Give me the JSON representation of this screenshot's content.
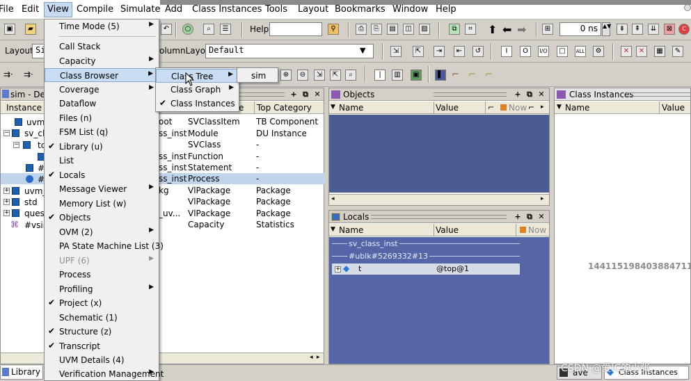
{
  "menubar": {
    "items": [
      "File",
      "Edit",
      "View",
      "Compile",
      "Simulate",
      "Add",
      "Class Instances",
      "Tools",
      "Layout",
      "Bookmarks",
      "Window",
      "Help"
    ]
  },
  "toolbar": {
    "help_label": "Help",
    "time_value": "0 ns",
    "layout_label": "Layout",
    "layout_value": "Si",
    "column_layout_label": "olumnLayout",
    "column_layout_value": "Default"
  },
  "sim_panel": {
    "title": "sim - Defa",
    "col_instance": "Instance",
    "col_design_unit_fragment": "e",
    "col_top_category": "Top Category",
    "tree_items": [
      "uvm_",
      "sv_cl",
      "tc",
      "#",
      "#",
      "uvm_",
      "std",
      "quest",
      "#vsim"
    ],
    "rows": [
      {
        "a": "oot",
        "b": "SVClassItem",
        "c": "TB Component"
      },
      {
        "a": "ss_inst",
        "b": "Module",
        "c": "DU Instance"
      },
      {
        "a": "",
        "b": "SVClass",
        "c": "-"
      },
      {
        "a": "ss_inst",
        "b": "Function",
        "c": "-"
      },
      {
        "a": "ss_inst",
        "b": "Statement",
        "c": "-"
      },
      {
        "a": "ss_inst",
        "b": "Process",
        "c": "-"
      },
      {
        "a": "kg",
        "b": "VlPackage",
        "c": "Package"
      },
      {
        "a": "",
        "b": "VlPackage",
        "c": "Package"
      },
      {
        "a": "_uv...",
        "b": "VlPackage",
        "c": "Package"
      },
      {
        "a": "",
        "b": "Capacity",
        "c": "Statistics"
      }
    ],
    "tab_label": "Library"
  },
  "objects_panel": {
    "title": "Objects",
    "col_name": "Name",
    "col_value": "Value",
    "col_now": "Now"
  },
  "locals_panel": {
    "title": "Locals",
    "col_name": "Name",
    "col_value": "Value",
    "col_now": "Now",
    "group1": "sv_class_inst",
    "group2": "#ublk#5269332#13",
    "item_name": "t",
    "item_value": "@top@1"
  },
  "class_instances_panel": {
    "title": "Class Instances",
    "col_name": "Name",
    "col_value": "Value",
    "tab_label": "Class Instances",
    "tab_other": "ave"
  },
  "overlay_number": "144115198403884711",
  "watermark": "CSDN @爱IC的小张",
  "view_menu": {
    "items": [
      {
        "label": "Time Mode (5)",
        "check": "",
        "arrow": "▶",
        "state": ""
      },
      {
        "label": "Call Stack",
        "check": "",
        "arrow": "",
        "state": ""
      },
      {
        "label": "Capacity",
        "check": "",
        "arrow": "▶",
        "state": ""
      },
      {
        "label": "Class Browser",
        "check": "",
        "arrow": "▶",
        "state": "hl"
      },
      {
        "label": "Coverage",
        "check": "",
        "arrow": "▶",
        "state": ""
      },
      {
        "label": "Dataflow",
        "check": "",
        "arrow": "",
        "state": ""
      },
      {
        "label": "Files (n)",
        "check": "",
        "arrow": "",
        "state": ""
      },
      {
        "label": "FSM List (q)",
        "check": "",
        "arrow": "",
        "state": ""
      },
      {
        "label": "Library (u)",
        "check": "✔",
        "arrow": "",
        "state": ""
      },
      {
        "label": "List",
        "check": "",
        "arrow": "",
        "state": ""
      },
      {
        "label": "Locals",
        "check": "✔",
        "arrow": "",
        "state": ""
      },
      {
        "label": "Message Viewer",
        "check": "",
        "arrow": "▶",
        "state": ""
      },
      {
        "label": "Memory List (w)",
        "check": "",
        "arrow": "",
        "state": ""
      },
      {
        "label": "Objects",
        "check": "✔",
        "arrow": "",
        "state": ""
      },
      {
        "label": "OVM (2)",
        "check": "",
        "arrow": "▶",
        "state": ""
      },
      {
        "label": "PA State Machine List (3)",
        "check": "",
        "arrow": "",
        "state": ""
      },
      {
        "label": "UPF (6)",
        "check": "",
        "arrow": "▶",
        "state": "dis"
      },
      {
        "label": "Process",
        "check": "",
        "arrow": "",
        "state": ""
      },
      {
        "label": "Profiling",
        "check": "",
        "arrow": "▶",
        "state": ""
      },
      {
        "label": "Project (x)",
        "check": "✔",
        "arrow": "",
        "state": ""
      },
      {
        "label": "Schematic (1)",
        "check": "",
        "arrow": "",
        "state": ""
      },
      {
        "label": "Structure  (z)",
        "check": "✔",
        "arrow": "",
        "state": ""
      },
      {
        "label": "Transcript",
        "check": "✔",
        "arrow": "",
        "state": ""
      },
      {
        "label": "UVM Details (4)",
        "check": "",
        "arrow": "",
        "state": ""
      },
      {
        "label": "Verification Management",
        "check": "",
        "arrow": "▶",
        "state": ""
      }
    ]
  },
  "class_browser_submenu": {
    "items": [
      {
        "label": "Class Tree",
        "check": "",
        "arrow": "▶",
        "state": "hl"
      },
      {
        "label": "Class Graph",
        "check": "",
        "arrow": "▶",
        "state": ""
      },
      {
        "label": "Class Instances",
        "check": "✔",
        "arrow": "",
        "state": ""
      }
    ]
  },
  "class_tree_submenu": {
    "items": [
      {
        "label": "sim"
      }
    ]
  }
}
